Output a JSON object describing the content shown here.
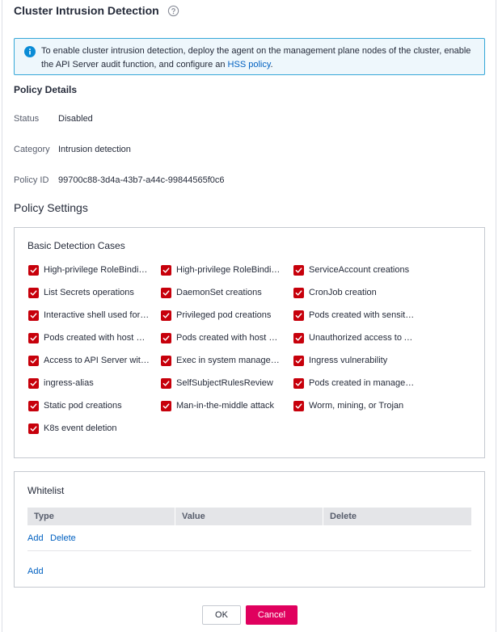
{
  "header": {
    "title": "Cluster Intrusion Detection",
    "help_icon": "question-circle-icon"
  },
  "info_banner": {
    "icon": "info-circle-icon",
    "text": "To enable cluster intrusion detection, deploy the agent on the management plane nodes of the cluster, enable the API Server audit function, and configure an ",
    "link_text": "HSS policy",
    "trailing": ".",
    "accent_color": "#35a7d8"
  },
  "policy_details": {
    "title": "Policy Details",
    "status_label": "Status",
    "status_value": "Disabled",
    "category_label": "Category",
    "category_value": "Intrusion detection",
    "policy_id_label": "Policy ID",
    "policy_id_value": "99700c88-3d4a-43b7-a44c-99844565f0c6"
  },
  "policy_settings": {
    "title": "Policy Settings",
    "cases_title": "Basic Detection Cases",
    "checkbox_color": "#c7000b",
    "cases": [
      {
        "label": "High-privilege RoleBinding ...",
        "checked": true
      },
      {
        "label": "High-privilege RoleBinding ...",
        "checked": true
      },
      {
        "label": "ServiceAccount creations",
        "checked": true
      },
      {
        "label": "List Secrets operations",
        "checked": true
      },
      {
        "label": "DaemonSet creations",
        "checked": true
      },
      {
        "label": "CronJob creation",
        "checked": true
      },
      {
        "label": "Interactive shell used for ex...",
        "checked": true
      },
      {
        "label": "Privileged pod creations",
        "checked": true
      },
      {
        "label": "Pods created with sensitive...",
        "checked": true
      },
      {
        "label": "Pods created with host net...",
        "checked": true
      },
      {
        "label": "Pods created with host PID...",
        "checked": true
      },
      {
        "label": "Unauthorized access to API...",
        "checked": true
      },
      {
        "label": "Access to API Server with c...",
        "checked": true
      },
      {
        "label": "Exec in system manageme...",
        "checked": true
      },
      {
        "label": "Ingress vulnerability",
        "checked": true
      },
      {
        "label": "ingress-alias",
        "checked": true
      },
      {
        "label": "SelfSubjectRulesReview",
        "checked": true
      },
      {
        "label": "Pods created in manageme...",
        "checked": true
      },
      {
        "label": "Static pod creations",
        "checked": true
      },
      {
        "label": "Man-in-the-middle attack",
        "checked": true
      },
      {
        "label": "Worm, mining, or Trojan",
        "checked": true
      },
      {
        "label": "K8s event deletion",
        "checked": true
      }
    ]
  },
  "whitelist": {
    "title": "Whitelist",
    "columns": [
      "Type",
      "Value",
      "Delete"
    ],
    "row_add": "Add",
    "row_delete": "Delete",
    "add_link": "Add"
  },
  "footer": {
    "ok_label": "OK",
    "cancel_label": "Cancel",
    "cancel_color": "#e0005e"
  }
}
